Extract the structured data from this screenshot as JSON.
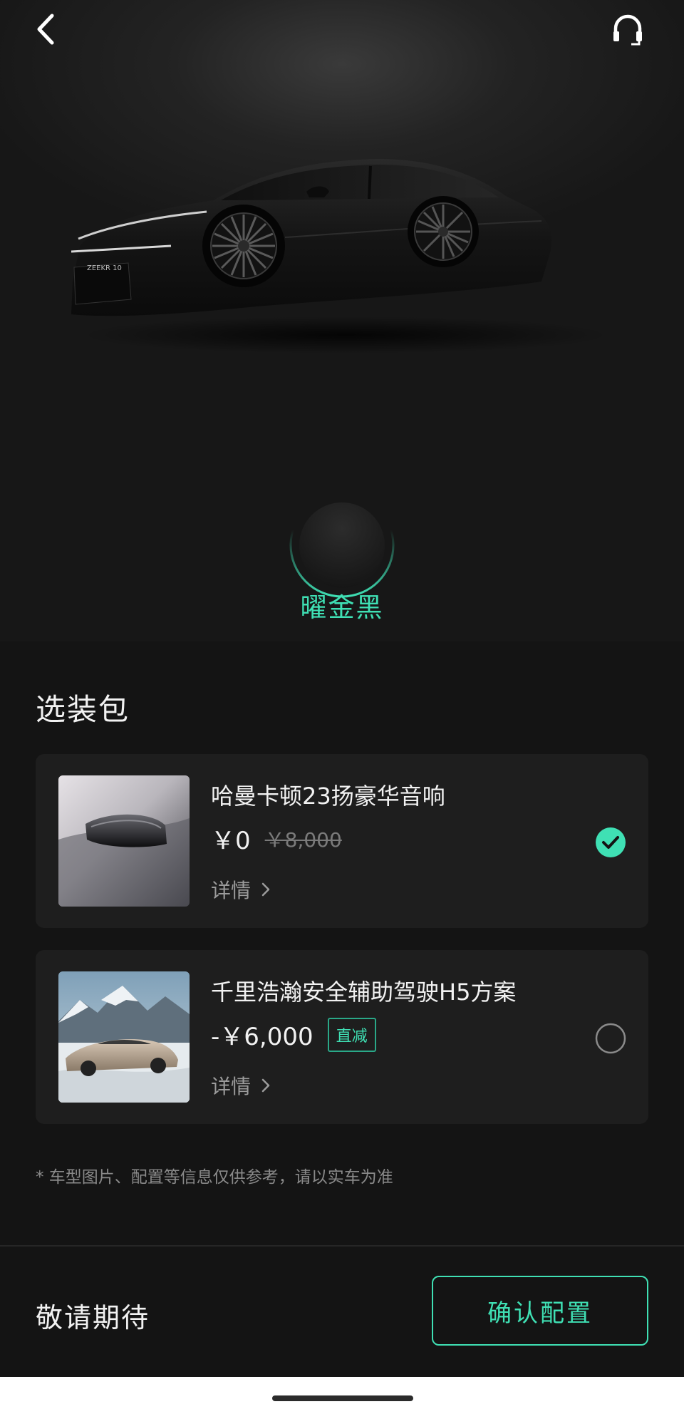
{
  "header": {
    "back_icon": "chevron-left-icon",
    "support_icon": "headset-icon"
  },
  "car": {
    "color_name": "曜金黑",
    "badge_text": "ZEEKR 10"
  },
  "packages": {
    "title": "选装包",
    "items": [
      {
        "name": "哈曼卡顿23扬豪华音响",
        "price": "￥0",
        "original_price": "￥8,000",
        "details_label": "详情",
        "selected": true
      },
      {
        "name": "千里浩瀚安全辅助驾驶H5方案",
        "price": "-￥6,000",
        "tag": "直减",
        "details_label": "详情",
        "selected": false
      }
    ]
  },
  "disclaimer": "* 车型图片、配置等信息仅供参考，请以实车为准",
  "footer": {
    "label": "敬请期待",
    "confirm_button": "确认配置"
  },
  "colors": {
    "accent": "#3fe0b4",
    "background": "#141414",
    "card": "#1e1e1e"
  }
}
